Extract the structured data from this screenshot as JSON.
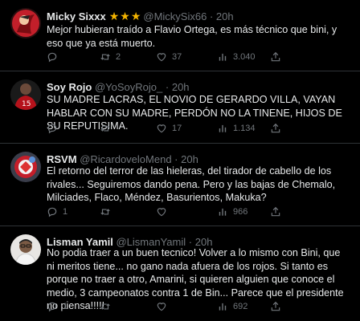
{
  "tweets": [
    {
      "name": "Micky Sixxx",
      "stars": "★★★",
      "handle": "@MickySix66",
      "separator": "·",
      "time": "20h",
      "text": "Mejor hubieran traído a Flavio Ortega, es más técnico que bini, y eso que ya está muerto.",
      "replies": "",
      "retweets": "2",
      "likes": "37",
      "views": "3.040"
    },
    {
      "name": "Soy Rojo",
      "handle": "@YoSoyRojo_",
      "separator": "·",
      "time": "20h",
      "text": "SU MADRE LACRAS, EL NOVIO DE GERARDO VILLA, VAYAN HABLAR CON SU MADRE, PERDÓN NO LA TINENE, HIJOS DE SU REPUTISIMA.",
      "replies": "",
      "retweets": "",
      "likes": "17",
      "views": "1.134"
    },
    {
      "name": "RSVM",
      "handle": "@RicardoveloMend",
      "separator": "·",
      "time": "20h",
      "text": "El retorno del terror de las hieleras, del tirador de cabello de los rivales... Seguiremos dando pena. Pero y las bajas de Chemalo, Milciades, Flaco, Méndez, Basurientos, Makuka?",
      "replies": "1",
      "retweets": "",
      "likes": "",
      "views": "966"
    },
    {
      "name": "Lisman Yamil",
      "handle": "@LismanYamil",
      "separator": "·",
      "time": "20h",
      "text": "No podia traer a un buen tecnico! Volver a lo mismo con Bini, que  ni meritos tiene... no gano nada afuera de los rojos. Si tanto es porque  no traer a otro, Amarini, si quieren alguien que conoce el medio, 3 campeonatos contra 1 de Bin... Parece que el presidente no piensa!!!!!",
      "replies": "1",
      "retweets": "",
      "likes": "",
      "views": "692"
    }
  ],
  "colors": {
    "background": "#000000",
    "text": "#e7e9ea",
    "muted": "#71767b",
    "divider": "#2f3336",
    "stars": "#f4b400"
  },
  "icons": [
    "reply-icon",
    "retweet-icon",
    "like-icon",
    "views-icon",
    "share-icon"
  ]
}
